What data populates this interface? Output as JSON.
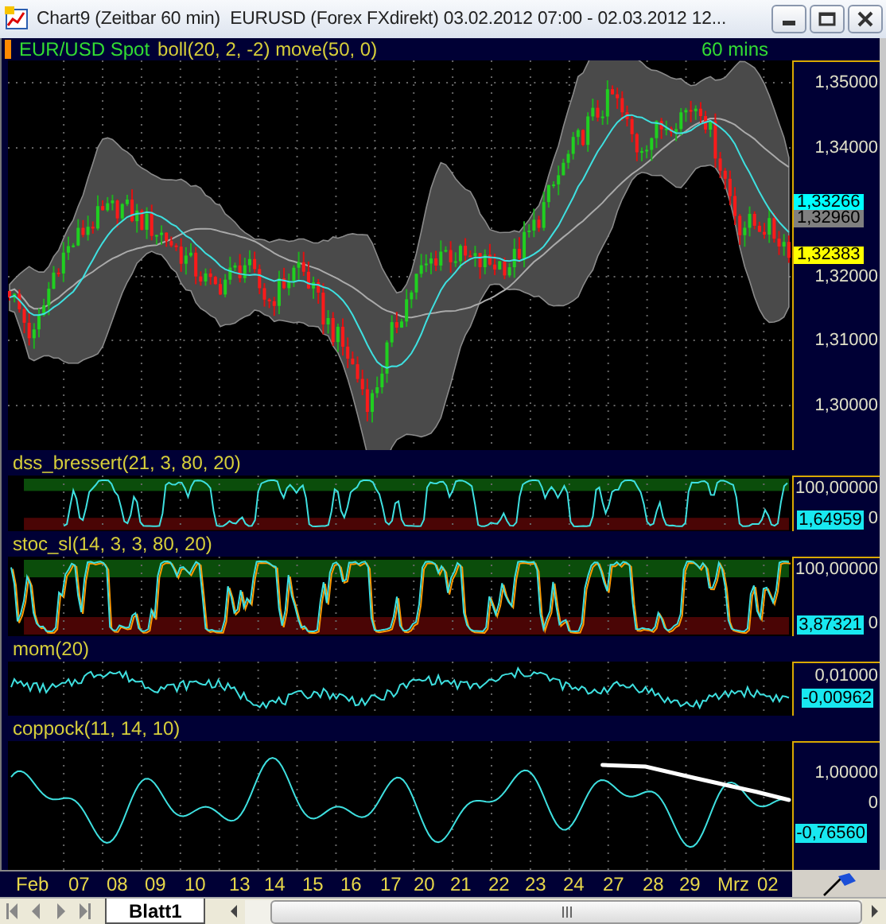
{
  "window": {
    "title": "Chart9 (Zeitbar 60 min)  EURUSD (Forex FXdirekt) 03.02.2012 07:00 - 02.03.2012 12..."
  },
  "panels": [
    {
      "kind": "price",
      "symbol": "EUR/USD Spot",
      "studies": "boll(20, 2, -2) move(50, 0)",
      "timeframe": "60 mins",
      "axis_labels": [
        "1,35000",
        "1,34000",
        "1,32000",
        "1,31000",
        "1,30000"
      ],
      "price_tags": [
        {
          "text": "1,33266",
          "color": "#00ffff"
        },
        {
          "text": "1,32960",
          "color": "#808080"
        },
        {
          "text": "1,32383",
          "color": "#ffff00"
        }
      ]
    },
    {
      "kind": "band",
      "title": "dss_bressert(21, 3, 80, 20)",
      "zones": true,
      "axis_labels": [
        "100,00000",
        "0"
      ],
      "value_tag": "1,64959"
    },
    {
      "kind": "band",
      "title": "stoc_sl(14, 3, 3, 80, 20)",
      "zones": true,
      "signal_line": true,
      "axis_labels": [
        "100,00000",
        "0"
      ],
      "value_tag": "3,87321"
    },
    {
      "kind": "momentum",
      "title": "mom(20)",
      "axis_labels": [
        "0,01000"
      ],
      "value_tag": "-0,00962"
    },
    {
      "kind": "coppock",
      "title": "coppock(11, 14, 10)",
      "trend_line": true,
      "axis_labels": [
        "1,00000",
        "0"
      ],
      "value_tag": "-0,76560"
    }
  ],
  "date_axis": [
    "Feb",
    "07",
    "08",
    "09",
    "10",
    "13",
    "14",
    "15",
    "16",
    "17",
    "20",
    "21",
    "22",
    "23",
    "24",
    "27",
    "28",
    "29",
    "Mrz",
    "02"
  ],
  "sheet_tabs": [
    {
      "label": "Blatt1",
      "selected": true
    }
  ]
}
